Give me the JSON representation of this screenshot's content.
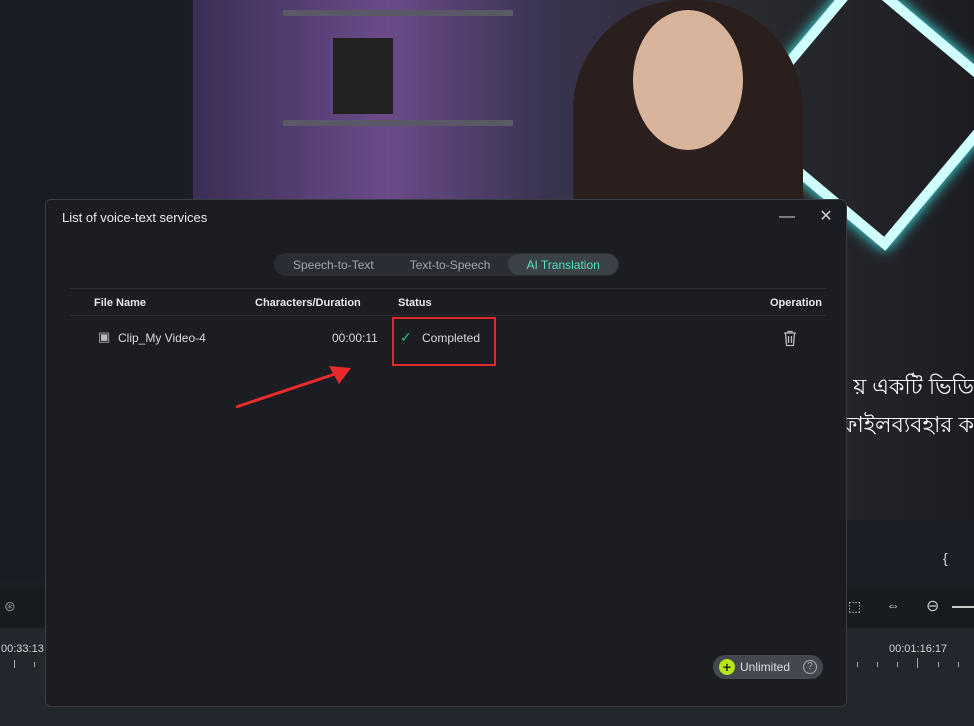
{
  "background": {
    "subtitle_lines": [
      "য় একটি ভিডি",
      "ফাইলব্যবহার ক"
    ],
    "timeline": {
      "timecode_left": "00:33:13",
      "timecode_right": "00:01:16:17"
    },
    "brace": "{"
  },
  "dialog": {
    "title": "List of voice-text services",
    "tabs": [
      {
        "label": "Speech-to-Text",
        "active": false
      },
      {
        "label": "Text-to-Speech",
        "active": false
      },
      {
        "label": "AI Translation",
        "active": true
      }
    ],
    "columns": [
      "File Name",
      "Characters/Duration",
      "Status",
      "Operation"
    ],
    "rows": [
      {
        "file_name": "Clip_My Video-4",
        "duration": "00:00:11",
        "status": "Completed",
        "status_icon": "check-icon",
        "operation_icon": "trash-icon"
      }
    ],
    "badge": {
      "label": "Unlimited",
      "icon": "plus-icon",
      "help_icon": "question-icon"
    }
  },
  "colors": {
    "accent": "#4fe3c1",
    "success": "#2ec16a",
    "highlight": "#e02a2a",
    "badge_plus": "#b5e61d"
  }
}
